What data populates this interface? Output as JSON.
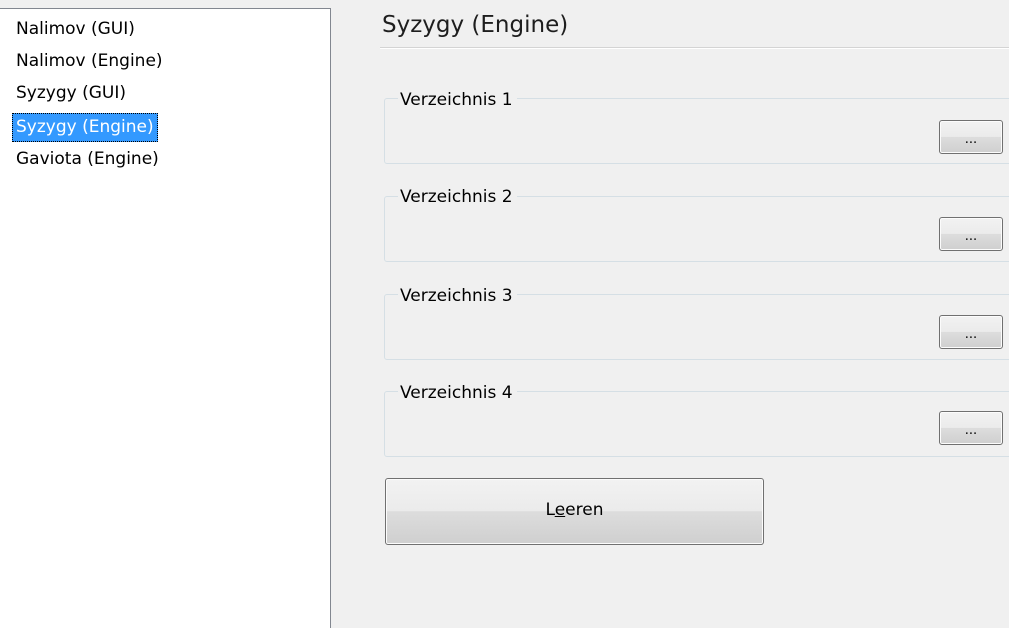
{
  "list": {
    "items": [
      {
        "label": "Nalimov (GUI)"
      },
      {
        "label": "Nalimov (Engine)"
      },
      {
        "label": "Syzygy (GUI)"
      },
      {
        "label": "Syzygy (Engine)",
        "selected": true
      },
      {
        "label": "Gaviota (Engine)"
      }
    ]
  },
  "page": {
    "title": "Syzygy (Engine)"
  },
  "directories": [
    {
      "label": "Verzeichnis 1",
      "button": "..."
    },
    {
      "label": "Verzeichnis 2",
      "button": "..."
    },
    {
      "label": "Verzeichnis 3",
      "button": "..."
    },
    {
      "label": "Verzeichnis 4",
      "button": "..."
    }
  ],
  "clear_button": {
    "label_before": "L",
    "label_mnemonic": "e",
    "label_after": "eren"
  },
  "colors": {
    "selection": "#3399ff",
    "window_background": "#f0f0f0"
  }
}
